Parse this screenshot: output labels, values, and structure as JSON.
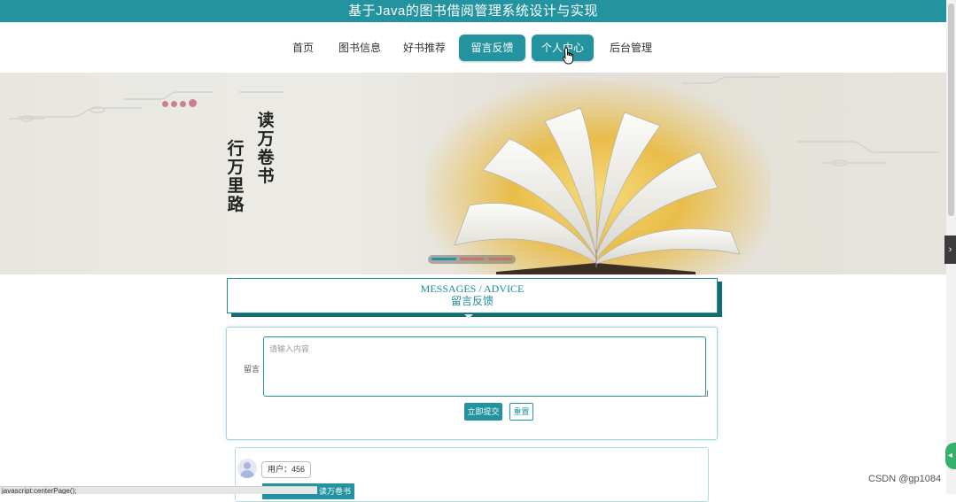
{
  "app": {
    "title": "基于Java的图书借阅管理系统设计与实现"
  },
  "nav": {
    "items": [
      {
        "label": "首页",
        "active": false
      },
      {
        "label": "图书信息",
        "active": false
      },
      {
        "label": "好书推荐",
        "active": false
      },
      {
        "label": "留言反馈",
        "active": true
      },
      {
        "label": "个人中心",
        "active": true
      },
      {
        "label": "后台管理",
        "active": false
      }
    ]
  },
  "banner": {
    "poem_line1": "读万卷书",
    "poem_line2": "行万里路",
    "slider_dots": 3,
    "slider_active": 1
  },
  "messages": {
    "heading_en": "MESSAGES / ADVICE",
    "heading_cn": "留言反馈"
  },
  "form": {
    "label": "留言",
    "placeholder": "请输入内容",
    "submit_label": "立即提交",
    "reset_label": "重置"
  },
  "comments": [
    {
      "user": "用户：456",
      "reply": "读万卷书"
    }
  ],
  "statusbar": {
    "text": "javascript:centerPage();"
  },
  "watermark": "CSDN @gp1084",
  "colors": {
    "accent": "#22939f",
    "accent_dark": "#166c74"
  }
}
